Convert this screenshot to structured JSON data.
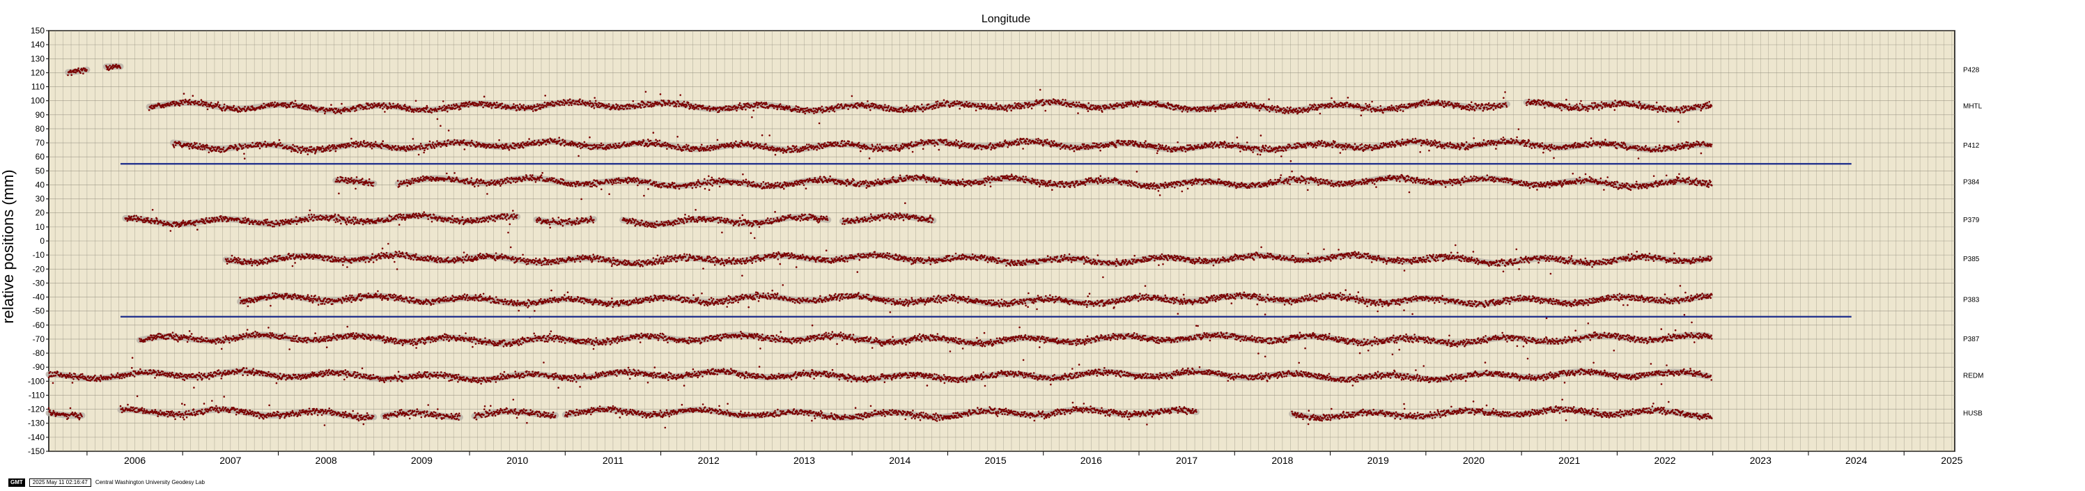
{
  "chart_data": {
    "type": "scatter",
    "title": "Longitude",
    "ylabel": "relative positions (mm)",
    "xlabel": "",
    "xlim": [
      2005.6,
      2025.53
    ],
    "ylim": [
      -150,
      150
    ],
    "x_ticks": [
      "2006",
      "2007",
      "2008",
      "2009",
      "2010",
      "2011",
      "2012",
      "2013",
      "2014",
      "2015",
      "2016",
      "2017",
      "2018",
      "2019",
      "2020",
      "2021",
      "2022",
      "2023",
      "2024",
      "2025"
    ],
    "y_ticks": [
      150,
      140,
      130,
      120,
      110,
      100,
      90,
      80,
      70,
      60,
      50,
      40,
      30,
      20,
      10,
      0,
      -10,
      -20,
      -30,
      -40,
      -50,
      -60,
      -70,
      -80,
      -90,
      -100,
      -110,
      -120,
      -130,
      -140,
      -150
    ],
    "grid": true,
    "colors": {
      "points": "#7a0000",
      "band": "#b8b2a8",
      "reference": "#1a2a8a",
      "background": "#ede6cf",
      "grid": "#8f8a7a"
    },
    "series": [
      {
        "name": "P428",
        "offset": 122,
        "segments": [
          [
            2005.8,
            2006.0
          ],
          [
            2006.2,
            2006.35
          ]
        ]
      },
      {
        "name": "MHTL",
        "offset": 96,
        "segments": [
          [
            2006.65,
            2020.85
          ],
          [
            2021.05,
            2022.99
          ]
        ]
      },
      {
        "name": "P412",
        "offset": 68,
        "segments": [
          [
            2006.9,
            2022.99
          ]
        ]
      },
      {
        "name": "P384",
        "offset": 42,
        "segments": [
          [
            2008.6,
            2009.0
          ],
          [
            2009.25,
            2022.99
          ]
        ]
      },
      {
        "name": "P379",
        "offset": 15,
        "segments": [
          [
            2006.4,
            2010.5
          ],
          [
            2010.7,
            2011.3
          ],
          [
            2011.6,
            2013.75
          ],
          [
            2013.9,
            2014.85
          ]
        ]
      },
      {
        "name": "P385",
        "offset": -13,
        "segments": [
          [
            2007.45,
            2022.99
          ]
        ]
      },
      {
        "name": "P383",
        "offset": -42,
        "segments": [
          [
            2007.6,
            2022.99
          ]
        ]
      },
      {
        "name": "P387",
        "offset": -70,
        "segments": [
          [
            2006.55,
            2022.99
          ]
        ]
      },
      {
        "name": "REDM",
        "offset": -96,
        "segments": [
          [
            2005.6,
            2022.99
          ]
        ]
      },
      {
        "name": "HUSB",
        "offset": -123,
        "segments": [
          [
            2005.6,
            2005.95
          ],
          [
            2006.35,
            2009.0
          ],
          [
            2009.1,
            2009.9
          ],
          [
            2010.05,
            2010.9
          ],
          [
            2011.0,
            2017.6
          ],
          [
            2018.6,
            2022.99
          ]
        ]
      }
    ],
    "reference_lines": [
      {
        "y": 55,
        "x": [
          2006.35,
          2024.45
        ]
      },
      {
        "y": -54,
        "x": [
          2006.35,
          2024.45
        ]
      }
    ]
  },
  "footer": {
    "logo": "GMT",
    "timestamp": "2025 May 11 02:16:47",
    "credit": "Central Washington University Geodesy Lab"
  }
}
